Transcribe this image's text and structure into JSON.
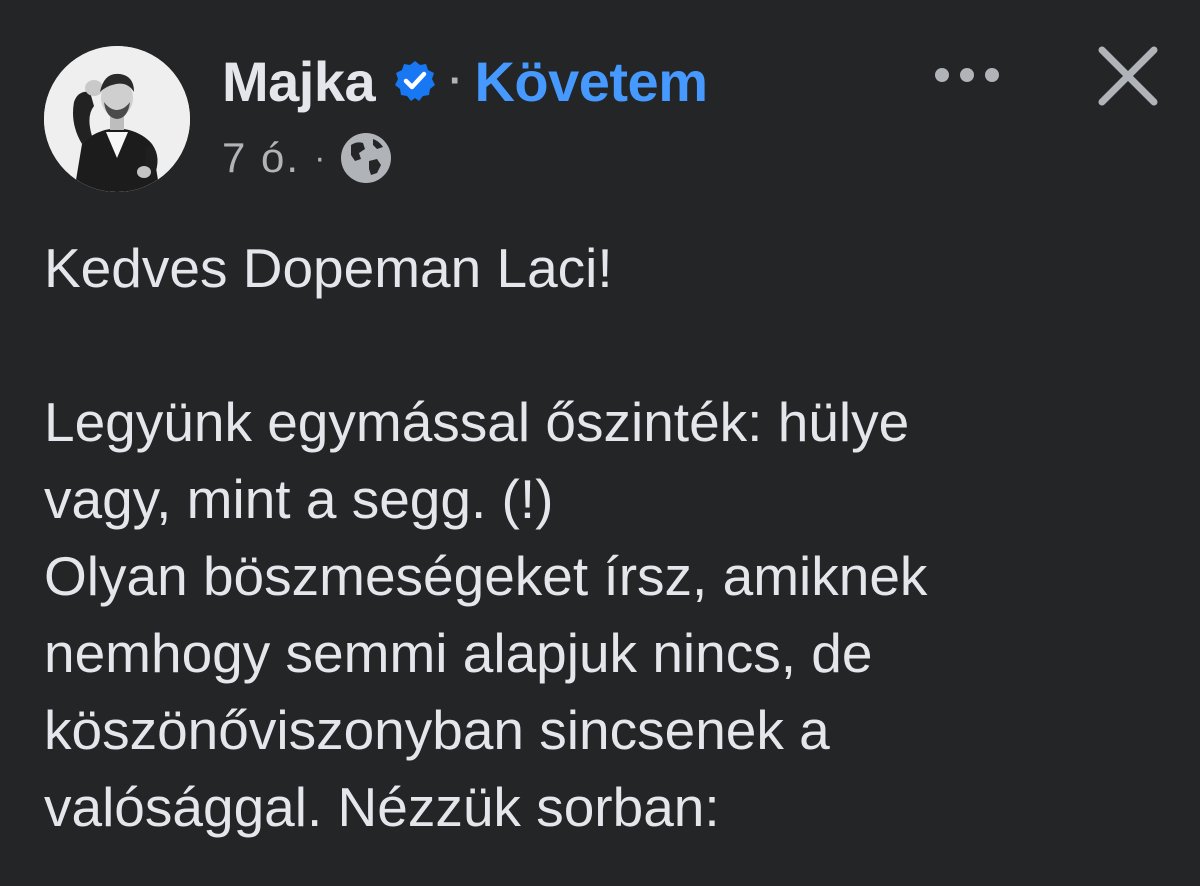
{
  "post": {
    "author": "Majka",
    "separator": "·",
    "follow_label": "Követem",
    "time": "7 ó.",
    "meta_separator": "·",
    "audience_icon": "globe-icon",
    "verified_icon": "verified-badge-icon",
    "more_icon": "more-options-icon",
    "close_icon": "close-icon",
    "lines": [
      "Kedves Dopeman Laci!",
      "",
      "Legyünk egymással őszinték: hülye",
      "vagy, mint a segg. (!)",
      "Olyan böszmeségeket írsz, amiknek",
      "nemhogy semmi alapjuk nincs, de",
      "köszönőviszonyban sincsenek a",
      "valósággal. Nézzük sorban:"
    ]
  },
  "colors": {
    "background": "#242526",
    "text": "#e4e6eb",
    "secondary_text": "#b0b3b8",
    "link": "#4599ff",
    "verified": "#1877f2"
  }
}
